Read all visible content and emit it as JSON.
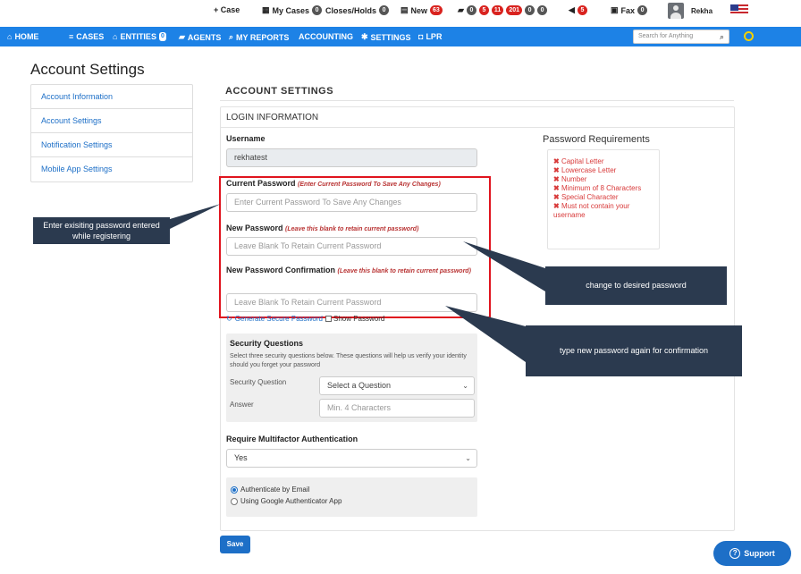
{
  "topbar": {
    "case": "+ Case",
    "my_cases": "My Cases",
    "my_cases_count": "0",
    "closes_holds": "Closes/Holds",
    "closes_holds_count": "0",
    "new": "New",
    "new_count": "63",
    "b1": "0",
    "b2": "5",
    "b3": "11",
    "b4": "201",
    "b5": "0",
    "b6": "0",
    "alerts_count": "5",
    "fax": "Fax",
    "fax_count": "0",
    "user": "Rekha"
  },
  "nav": {
    "home": "HOME",
    "cases": "CASES",
    "entities": "ENTITIES",
    "entities_badge": "0",
    "agents": "AGENTS",
    "my_reports": "MY REPORTS",
    "accounting": "ACCOUNTING",
    "settings": "SETTINGS",
    "lpr": "LPR",
    "search_placeholder": "Search for Anything"
  },
  "page_title": "Account Settings",
  "sidebar": {
    "items": [
      {
        "label": "Account Information"
      },
      {
        "label": "Account Settings"
      },
      {
        "label": "Notification Settings"
      },
      {
        "label": "Mobile App Settings"
      }
    ]
  },
  "form": {
    "section_title": "ACCOUNT SETTINGS",
    "login_info": "LOGIN INFORMATION",
    "username_label": "Username",
    "username_value": "rekhatest",
    "current_pw_label": "Current Password",
    "current_pw_hint": "(Enter Current Password To Save Any Changes)",
    "current_pw_placeholder": "Enter Current Password To Save Any Changes",
    "new_pw_label": "New Password",
    "new_pw_hint": "(Leave this blank to retain current password)",
    "new_pw_placeholder": "Leave Blank To Retain Current Password",
    "confirm_pw_label": "New Password Confirmation",
    "confirm_pw_hint": "(Leave this blank to retain current password)",
    "confirm_pw_placeholder": "Leave Blank To Retain Current Password",
    "generate_pw": "Generate Secure Password",
    "show_pw": "Show Password",
    "sq_title": "Security Questions",
    "sq_desc": "Select three security questions below. These questions will help us verify your identity should you forget your password",
    "sq_label": "Security Question",
    "sq_select": "Select a Question",
    "answer_label": "Answer",
    "answer_placeholder": "Min. 4 Characters",
    "mfa_title": "Require Multifactor Authentication",
    "mfa_value": "Yes",
    "auth_email": "Authenticate by Email",
    "auth_google": "Using Google Authenticator App",
    "save": "Save"
  },
  "password_requirements": {
    "title": "Password Requirements",
    "items": [
      "Capital Letter",
      "Lowercase Letter",
      "Number",
      "Minimum of 8 Characters",
      "Special Character",
      "Must not contain your username"
    ]
  },
  "callouts": {
    "existing": "Enter exisiting password entered while registering",
    "desired": "change to desired password",
    "confirm": "type new password again for confirmation"
  },
  "support": "Support"
}
